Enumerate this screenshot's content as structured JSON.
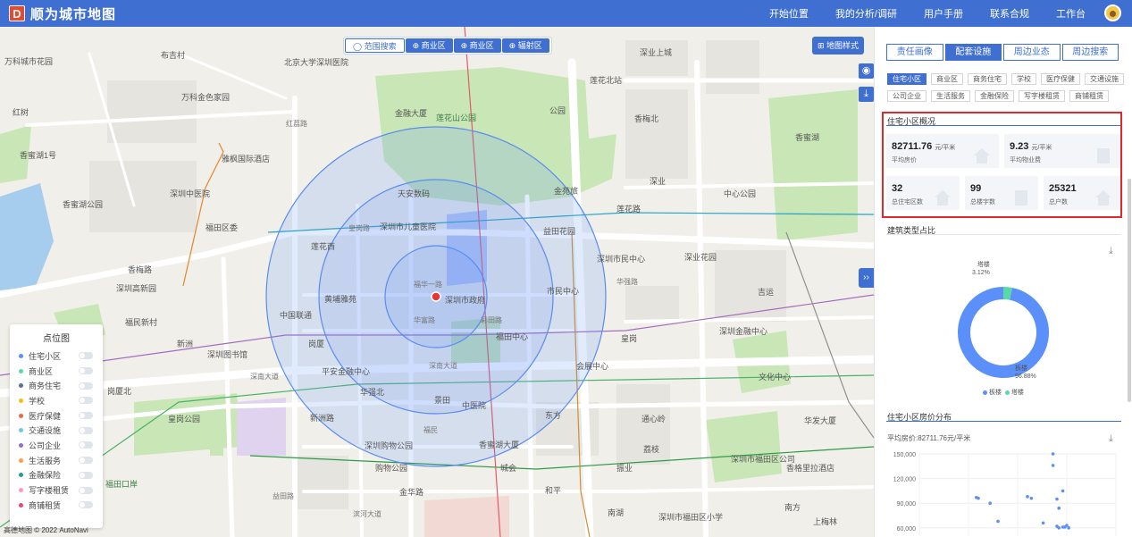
{
  "app": {
    "logo_letter": "D",
    "title": "顺为城市地图"
  },
  "topnav": [
    "开始位置",
    "我的分析/调研",
    "用户手册",
    "联系合规",
    "工作台"
  ],
  "map": {
    "tabs": [
      {
        "label": "◯ 范围搜索",
        "active": true
      },
      {
        "label": "⊕ 商业区",
        "active": false
      },
      {
        "label": "⊕ 商业区",
        "active": false
      },
      {
        "label": "⊕ 辐射区",
        "active": false
      }
    ],
    "style_button": "⊞ 地图样式",
    "copyright": "高德地图 © 2022 AutoNavi",
    "labels": {
      "wanke": "万科城市花园",
      "buji": "布吉村",
      "beida": "北京大学深圳医院",
      "chenghuaxi": "深业上城",
      "jinyuan": "金苑旅",
      "lianhua_zhan": "莲花北站",
      "lianhuaxi": "莲花西",
      "lianhua_shan": "莲花山公园",
      "jinrong": "金融大厦",
      "fanghua": "万科金色家园",
      "hongshu": "红树",
      "shenzhen_hosp": "深圳中医院",
      "qiaoxiang": "香蜜湖1号",
      "hotel": "雅枫国际酒店",
      "xiangmi_park": "香蜜湖公园",
      "tianan": "天安数码",
      "children": "深圳市儿童医院",
      "huamei": "福田区委",
      "futian_gov": "深圳市政府",
      "zhongxin": "市民中心",
      "shangye": "中国联通",
      "duanhai": "黄埔雅苑",
      "yitian": "益田花园",
      "futian_center": "福田中心",
      "yibu": "深圳图书馆",
      "gangxia": "岗厦",
      "huafu": "华富路",
      "huaqiang": "华强北",
      "shenzhen_bay": "深圳湾",
      "shenzhen_road": "深南大道",
      "zhongshan": "深圳高新园",
      "jingtian": "景田",
      "xiangmei": "香梅路",
      "fuhua": "福华一路",
      "shopping": "深圳购物公园",
      "gwanze": "购物公园",
      "huanggang": "皇岗",
      "pingan": "平安金融中心",
      "huanggang_road": "皇岗路",
      "convention": "会展中心",
      "shimin": "深圳市民中心",
      "wenhua": "文化中心",
      "xinzhou": "新洲路",
      "shennan": "深南大道",
      "huaqiang_road": "华强路",
      "binhe": "滨河大道",
      "yitian_road": "益田路",
      "fumin": "福民",
      "futian_port": "福田口岸",
      "xinzhou_road": "新洲",
      "jinhua": "金华路",
      "hotel2": "香格里拉酒店",
      "nanhu": "南湖",
      "lian_road": "莲花路",
      "hongli": "红荔路",
      "gongsi": "深圳市福田区公司",
      "shan1": "深业花园",
      "xiangmihu_park": "香蜜湖",
      "center_right": "中心公园",
      "tongxin": "通心岭",
      "jiyun": "吉运",
      "dongfang": "东方",
      "zhongyi": "中医院",
      "xiangmi": "香蜜湖大厦",
      "lizhi": "荔枝",
      "xiang2": "香梅北",
      "huanggang_park": "皇岗公园",
      "fumin_new": "福民新村",
      "shenzhen_finance": "深圳金融中心",
      "gangxia_north": "岗厦北",
      "caitian": "彩田路",
      "shenye": "深业",
      "gongyuan": "公园",
      "xiaoxue": "深圳市福田区小学",
      "chenghui": "城会",
      "zhenyuan": "振业",
      "heping": "和平",
      "huafa": "华发大厦",
      "nanfang": "南方",
      "shangmei": "上梅林"
    }
  },
  "legend": {
    "title": "点位图",
    "items": [
      {
        "name": "住宅小区",
        "color": "#5b8ff9"
      },
      {
        "name": "商业区",
        "color": "#5ad8a6"
      },
      {
        "name": "商务住宅",
        "color": "#5d7092"
      },
      {
        "name": "学校",
        "color": "#f6bd16"
      },
      {
        "name": "医疗保健",
        "color": "#e8684a"
      },
      {
        "name": "交通设施",
        "color": "#6dc8ec"
      },
      {
        "name": "公司企业",
        "color": "#9270ca"
      },
      {
        "name": "生活服务",
        "color": "#ff9d4d"
      },
      {
        "name": "金融保险",
        "color": "#269a99"
      },
      {
        "name": "写字楼租赁",
        "color": "#ff99c3"
      },
      {
        "name": "商铺租赁",
        "color": "#e8467c"
      }
    ]
  },
  "panel": {
    "tabs": [
      {
        "label": "责任画像",
        "active": false
      },
      {
        "label": "配套设施",
        "active": true
      },
      {
        "label": "周边业态",
        "active": false
      },
      {
        "label": "周边搜索",
        "active": false
      }
    ],
    "categories_row1": [
      {
        "label": "住宅小区",
        "active": true
      },
      {
        "label": "商业区",
        "active": false
      },
      {
        "label": "商务住宅",
        "active": false
      },
      {
        "label": "学校",
        "active": false
      },
      {
        "label": "医疗保健",
        "active": false
      },
      {
        "label": "交通设施",
        "active": false
      }
    ],
    "categories_row2": [
      {
        "label": "公司企业",
        "active": false
      },
      {
        "label": "生活服务",
        "active": false
      },
      {
        "label": "金融保险",
        "active": false
      },
      {
        "label": "写字楼租赁",
        "active": false
      },
      {
        "label": "商铺租赁",
        "active": false
      }
    ],
    "overview": {
      "title": "住宅小区概况",
      "stats": [
        {
          "value": "82711.76",
          "unit": "元/平米",
          "label": "平均房价"
        },
        {
          "value": "9.23",
          "unit": "元/平米",
          "label": "平均物业费"
        },
        {
          "value": "32",
          "unit": "",
          "label": "总住宅区数"
        },
        {
          "value": "99",
          "unit": "",
          "label": "总楼宇数"
        },
        {
          "value": "25321",
          "unit": "",
          "label": "总户数"
        }
      ]
    },
    "donut": {
      "title": "建筑类型占比",
      "legend": [
        "板楼",
        "塔楼"
      ],
      "label_small": "塔楼",
      "label_small_pct": "3.12%",
      "label_big": "板楼",
      "label_big_pct": "96.88%"
    },
    "scatter": {
      "title": "住宅小区房价分布",
      "subtitle": "平均房价:82711.76元/平米"
    }
  },
  "chart_data": [
    {
      "type": "pie",
      "title": "建筑类型占比",
      "categories": [
        "板楼",
        "塔楼"
      ],
      "values": [
        96.88,
        3.12
      ],
      "colors": [
        "#5b8ff9",
        "#5ad8a6"
      ],
      "legend": "bottom"
    },
    {
      "type": "scatter",
      "title": "住宅小区房价分布",
      "subtitle": "平均房价:82711.76元/平米",
      "y_ticks": [
        60000,
        90000,
        120000,
        150000
      ],
      "ylim": [
        50000,
        150000
      ],
      "xlim": [
        0,
        100
      ],
      "grid": true,
      "series": [
        {
          "color": "#5b8ff9",
          "points": [
            [
              68,
              150000
            ],
            [
              68,
              136000
            ],
            [
              73,
              105000
            ],
            [
              29,
              97000
            ],
            [
              30,
              96000
            ],
            [
              55,
              98000
            ],
            [
              57,
              96000
            ],
            [
              70,
              95000
            ],
            [
              36,
              90000
            ],
            [
              71,
              84000
            ],
            [
              40,
              68000
            ],
            [
              63,
              66000
            ],
            [
              75,
              63000
            ],
            [
              70,
              62000
            ],
            [
              73,
              61000
            ],
            [
              71,
              60000
            ],
            [
              76,
              60000
            ],
            [
              74,
              61000
            ]
          ]
        }
      ]
    }
  ]
}
